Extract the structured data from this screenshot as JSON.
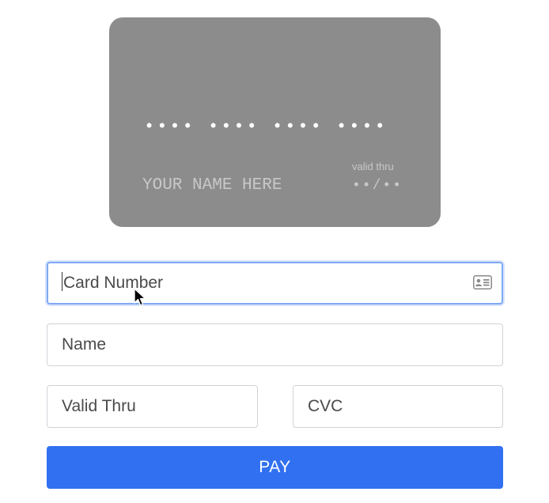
{
  "card_preview": {
    "number_masked": "•••• •••• •••• ••••",
    "name_placeholder": "YOUR NAME HERE",
    "valid_label": "valid thru",
    "expiry_masked": "••/••",
    "background_color": "#8c8c8c"
  },
  "form": {
    "card_number": {
      "placeholder": "Card Number",
      "value": "",
      "focused": true,
      "icon": "contact-card-icon"
    },
    "name": {
      "placeholder": "Name",
      "value": ""
    },
    "valid_thru": {
      "placeholder": "Valid Thru",
      "value": ""
    },
    "cvc": {
      "placeholder": "CVC",
      "value": ""
    },
    "pay_button": {
      "label": "PAY",
      "color": "#3170f0"
    }
  },
  "pointer": {
    "icon": "mouse-pointer-icon"
  }
}
